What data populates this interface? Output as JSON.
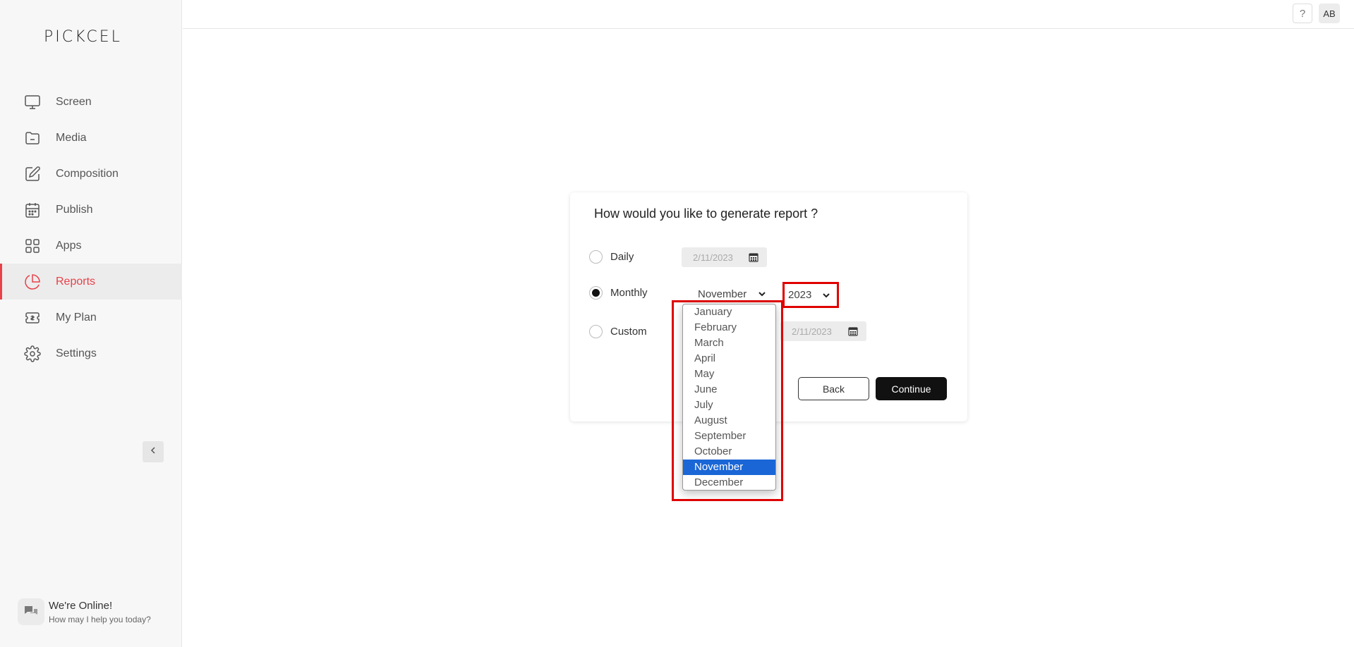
{
  "app": {
    "logo": "PICKCEL"
  },
  "sidebar": {
    "items": [
      {
        "label": "Screen",
        "icon": "monitor-icon",
        "active": false
      },
      {
        "label": "Media",
        "icon": "folder-icon",
        "active": false
      },
      {
        "label": "Composition",
        "icon": "edit-icon",
        "active": false
      },
      {
        "label": "Publish",
        "icon": "calendar-icon",
        "active": false
      },
      {
        "label": "Apps",
        "icon": "grid-icon",
        "active": false
      },
      {
        "label": "Reports",
        "icon": "pie-chart-icon",
        "active": true
      },
      {
        "label": "My Plan",
        "icon": "ticket-icon",
        "active": false
      },
      {
        "label": "Settings",
        "icon": "gear-icon",
        "active": false
      }
    ],
    "collapse_icon": "chevron-left-icon"
  },
  "chat": {
    "title": "We're Online!",
    "subtitle": "How may I help you today?"
  },
  "topbar": {
    "help": "?",
    "avatar": "AB"
  },
  "dialog": {
    "title": "How would you like to generate report ?",
    "options": {
      "daily": {
        "label": "Daily",
        "date": "2/11/2023"
      },
      "monthly": {
        "label": "Monthly",
        "month": "November",
        "year": "2023"
      },
      "custom": {
        "label": "Custom",
        "date": "2/11/2023"
      }
    },
    "selected_option": "Monthly",
    "back_label": "Back",
    "continue_label": "Continue"
  },
  "month_dropdown": {
    "options": [
      "January",
      "February",
      "March",
      "April",
      "May",
      "June",
      "July",
      "August",
      "September",
      "October",
      "November",
      "December"
    ],
    "selected": "November"
  },
  "colors": {
    "accent": "#e8414a",
    "highlight": "#e00000",
    "selection": "#1a66d6"
  }
}
